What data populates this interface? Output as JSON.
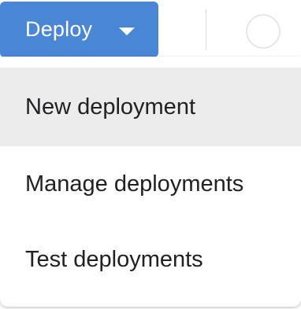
{
  "deploy_button": {
    "label": "Deploy",
    "caret_icon": "caret-down-icon",
    "color": "#4a86d6"
  },
  "avatar_icon": "account-icon",
  "menu": {
    "items": [
      {
        "label": "New deployment",
        "highlighted": true
      },
      {
        "label": "Manage deployments",
        "highlighted": false
      },
      {
        "label": "Test deployments",
        "highlighted": false
      }
    ],
    "highlight_color": "#ececec"
  }
}
